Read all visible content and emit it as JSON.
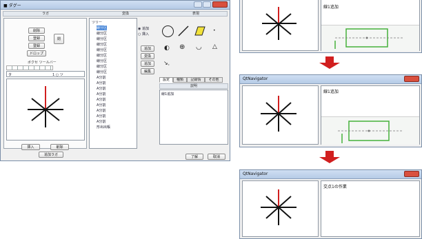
{
  "main_dialog": {
    "title": "■ ダグー",
    "group_headers": [
      "ラガ",
      "変換",
      "表現"
    ],
    "left_buttons": [
      "削除",
      "登録",
      "登録",
      "ドロップ"
    ],
    "side_button": "閉",
    "sub_header": "ボクセ ツールバー",
    "field_label": "タ",
    "field_value": "1 ○ ツ",
    "list_root": "ツリー",
    "list_items": [
      "線分区",
      "線分区",
      "線分区",
      "線分区",
      "線分区",
      "線分区",
      "線分区",
      "線分区",
      "線分区",
      "A分割",
      "A分割",
      "A分割",
      "A分割",
      "A分割",
      "A分割",
      "A分割",
      "A分割",
      "A分割",
      "形出出帳"
    ],
    "radio_options": [
      "追加",
      "挿入"
    ],
    "mid_buttons": [
      "追加",
      "変換",
      "追加",
      "編集"
    ],
    "tabs": [
      "設定",
      "種類",
      "記録情",
      "その他"
    ],
    "memo_header": "説明",
    "memo_text": "線1追加",
    "bottom_buttons": [
      "挿入",
      "削除"
    ],
    "bottom_center_button": "追加ラガ",
    "ok_button": "了解",
    "cancel_button": "取消"
  },
  "navigator_windows": [
    {
      "title": "",
      "memo": "線1追加",
      "has_preview": true
    },
    {
      "title": "QtNavigator",
      "memo": "線1追加",
      "has_preview": true
    },
    {
      "title": "QtNavigator",
      "memo": "交点1の作業",
      "has_preview": false
    }
  ],
  "colors": {
    "arrow": "#d11f1f",
    "preview_box": "#45b03a",
    "accent_line": "#d11f1f"
  }
}
